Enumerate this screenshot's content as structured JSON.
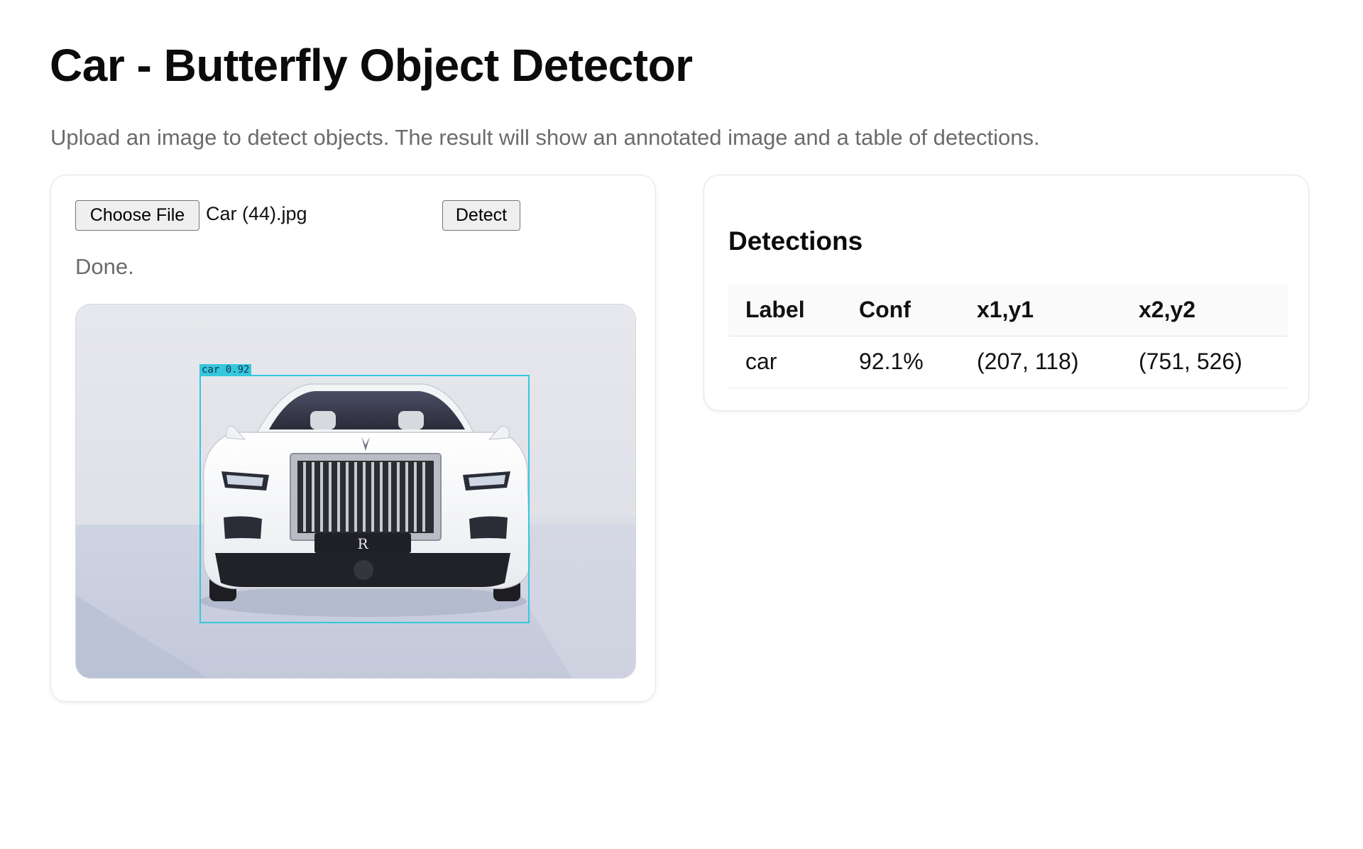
{
  "page": {
    "title": "Car - Butterfly Object Detector",
    "subtitle": "Upload an image to detect objects. The result will show an annotated image and a table of detections."
  },
  "upload": {
    "choose_file_label": "Choose File",
    "file_name": "Car (44).jpg",
    "detect_label": "Detect",
    "status": "Done."
  },
  "result": {
    "box_label": "car 0.92",
    "box_color": "#36c6dd"
  },
  "detections": {
    "title": "Detections",
    "columns": [
      "Label",
      "Conf",
      "x1,y1",
      "x2,y2"
    ],
    "rows": [
      {
        "label": "car",
        "conf": "92.1%",
        "xy1": "(207, 118)",
        "xy2": "(751, 526)"
      }
    ]
  }
}
